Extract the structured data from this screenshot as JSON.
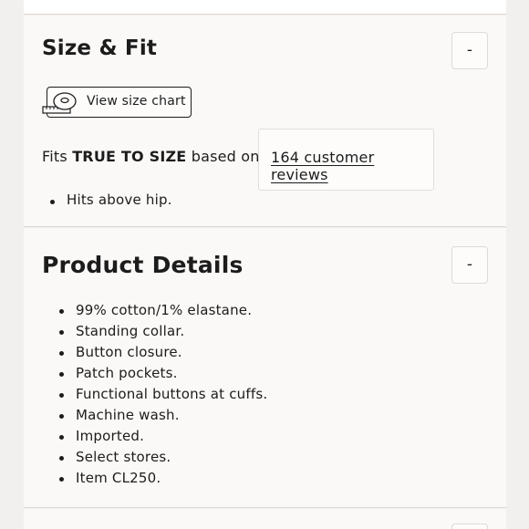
{
  "size_fit": {
    "title": "Size & Fit",
    "toggle": "-",
    "size_chart_label": "View size chart",
    "fits_prefix": "Fits ",
    "fits_emphasis": "TRUE TO SIZE",
    "fits_suffix": " based on",
    "reviews_link": "164 customer reviews",
    "bullets": [
      "Hits above hip."
    ]
  },
  "product_details": {
    "title": "Product Details",
    "toggle": "-",
    "bullets": [
      "99% cotton/1% elastane.",
      "Standing collar.",
      "Button closure.",
      "Patch pockets.",
      "Functional buttons at cuffs.",
      "Machine wash.",
      "Imported.",
      "Select stores.",
      "Item CL250."
    ]
  },
  "icons": {
    "size_chart": "measuring-tape-icon"
  }
}
